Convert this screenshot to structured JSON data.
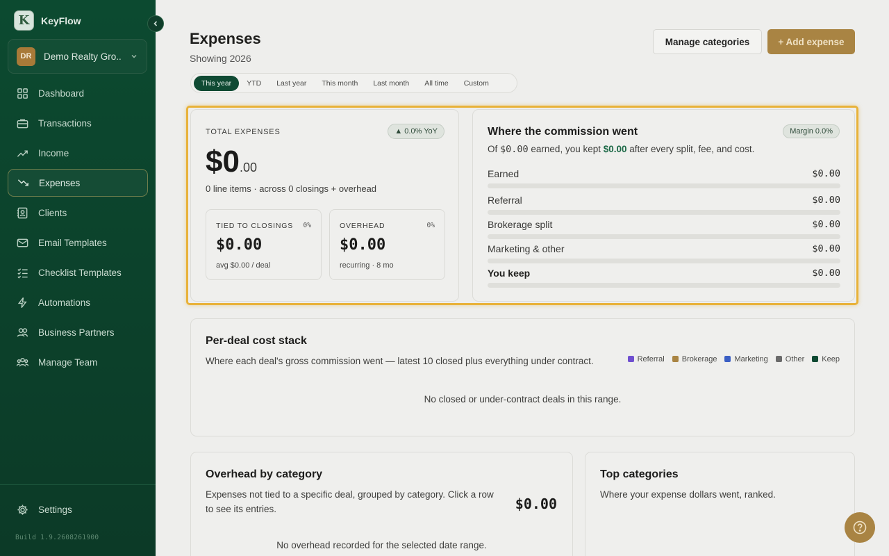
{
  "sidebar": {
    "brand": "KeyFlow",
    "org_initials": "DR",
    "org_name": "Demo Realty Gro...",
    "items": [
      {
        "label": "Dashboard",
        "icon": "grid-icon"
      },
      {
        "label": "Transactions",
        "icon": "briefcase-icon"
      },
      {
        "label": "Income",
        "icon": "trend-up-icon"
      },
      {
        "label": "Expenses",
        "icon": "trend-down-icon",
        "active": true
      },
      {
        "label": "Clients",
        "icon": "contacts-icon"
      },
      {
        "label": "Email Templates",
        "icon": "mail-icon"
      },
      {
        "label": "Checklist Templates",
        "icon": "checklist-icon"
      },
      {
        "label": "Automations",
        "icon": "bolt-icon"
      },
      {
        "label": "Business Partners",
        "icon": "partners-icon"
      },
      {
        "label": "Manage Team",
        "icon": "team-icon"
      }
    ],
    "settings": "Settings",
    "build": "Build 1.9.2608261900"
  },
  "header": {
    "title": "Expenses",
    "subtitle": "Showing 2026",
    "manage_label": "Manage categories",
    "add_label": "+ Add expense"
  },
  "ranges": [
    "This year",
    "YTD",
    "Last year",
    "This month",
    "Last month",
    "All time",
    "Custom"
  ],
  "active_range": "This year",
  "total": {
    "label": "TOTAL EXPENSES",
    "yoy": "▲ 0.0% YoY",
    "amount_whole": "$0",
    "amount_cents": ".00",
    "summary": "0 line items · across 0 closings + overhead",
    "tied": {
      "label": "TIED TO CLOSINGS",
      "pct": "0%",
      "amount": "$0.00",
      "note": "avg $0.00 / deal"
    },
    "overhead": {
      "label": "OVERHEAD",
      "pct": "0%",
      "amount": "$0.00",
      "note": "recurring · 8 mo"
    }
  },
  "commission": {
    "title": "Where the commission went",
    "margin": "Margin 0.0%",
    "sub_prefix": "Of ",
    "sub_earned": "$0.00",
    "sub_mid": " earned, you kept ",
    "sub_kept": "$0.00",
    "sub_suffix": " after every split, fee, and cost.",
    "rows": [
      {
        "name": "Earned",
        "value": "$0.00"
      },
      {
        "name": "Referral",
        "value": "$0.00"
      },
      {
        "name": "Brokerage split",
        "value": "$0.00"
      },
      {
        "name": "Marketing & other",
        "value": "$0.00"
      },
      {
        "name": "You keep",
        "value": "$0.00"
      }
    ]
  },
  "cost_stack": {
    "title": "Per-deal cost stack",
    "description": "Where each deal's gross commission went — latest 10 closed plus everything under contract.",
    "legend": [
      {
        "label": "Referral",
        "color": "#6f4fd0"
      },
      {
        "label": "Brokerage",
        "color": "#a98443"
      },
      {
        "label": "Marketing",
        "color": "#3b5fc4"
      },
      {
        "label": "Other",
        "color": "#6a6a6a"
      },
      {
        "label": "Keep",
        "color": "#0f4a33"
      }
    ],
    "empty": "No closed or under-contract deals in this range."
  },
  "overhead_card": {
    "title": "Overhead by category",
    "description": "Expenses not tied to a specific deal, grouped by category. Click a row to see its entries.",
    "amount": "$0.00",
    "empty": "No overhead recorded for the selected date range."
  },
  "top_categories": {
    "title": "Top categories",
    "description": "Where your expense dollars went, ranked."
  },
  "colors": {
    "sidebar": "#0c4a30",
    "accent": "#a98443",
    "highlight": "#e8b23a",
    "kept": "#1e6a48"
  }
}
